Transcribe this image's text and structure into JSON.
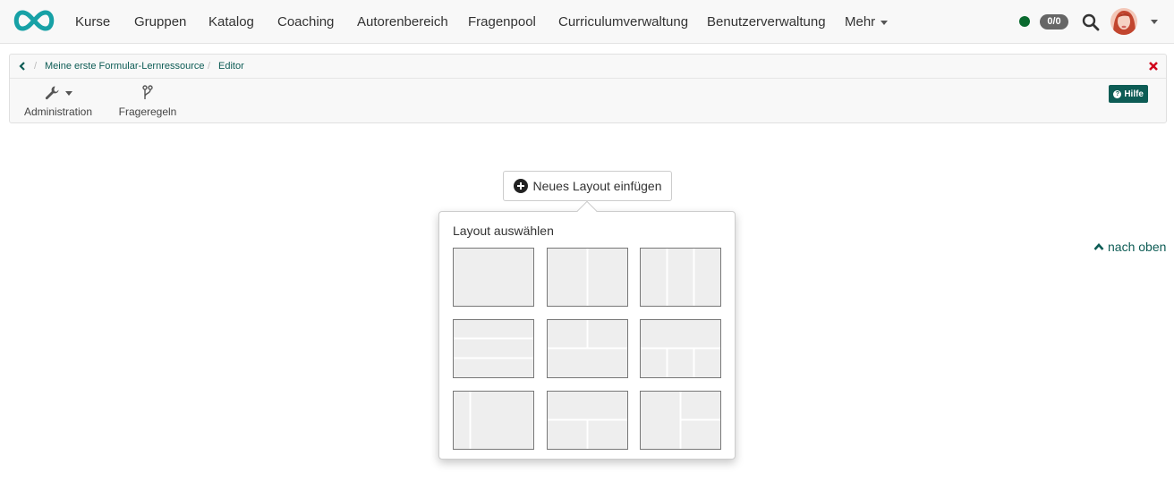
{
  "nav": {
    "items": [
      "Kurse",
      "Gruppen",
      "Katalog",
      "Coaching",
      "Autorenbereich",
      "Fragenpool",
      "Curriculumverwaltung",
      "Benutzerverwaltung",
      "Mehr"
    ],
    "counter": "0/0",
    "status_color": "#0a6a2f"
  },
  "breadcrumb": {
    "items": [
      "Meine erste Formular-Lernressource",
      "Editor"
    ]
  },
  "toolbar": {
    "administration_label": "Administration",
    "frageregeln_label": "Frageregeln",
    "help_label": "Hilfe"
  },
  "insert": {
    "button_label": "Neues Layout einfügen",
    "popover_title": "Layout auswählen"
  },
  "layouts": [
    "single-column",
    "two-columns",
    "three-columns",
    "three-rows",
    "two-columns-over-full",
    "full-over-three-columns",
    "narrow-left-wide-right",
    "full-over-two-columns",
    "left-with-right-split"
  ],
  "back_to_top": "nach oben",
  "colors": {
    "accent": "#0d5c55",
    "logo": "#17a1a6",
    "close": "#d0021b"
  }
}
